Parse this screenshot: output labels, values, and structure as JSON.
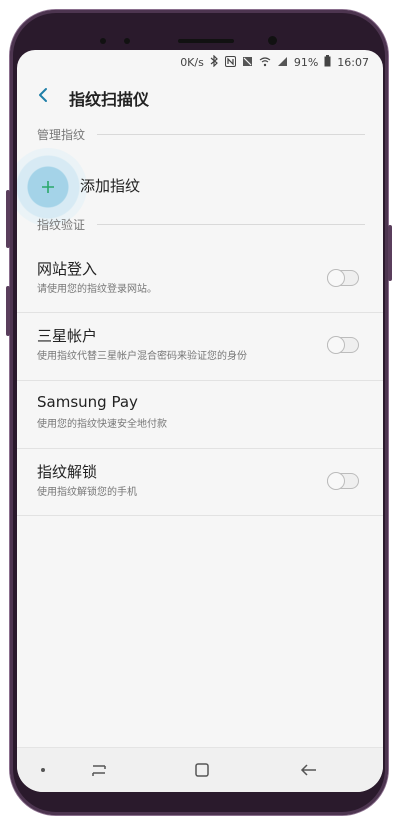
{
  "status_bar": {
    "speed": "0K/s",
    "battery": "91%",
    "time": "16:07"
  },
  "header": {
    "title": "指纹扫描仪"
  },
  "sections": {
    "manage": "管理指纹",
    "verify": "指纹验证"
  },
  "add_fingerprint": {
    "label": "添加指纹"
  },
  "items": [
    {
      "title": "网站登入",
      "subtitle": "请使用您的指纹登录网站。"
    },
    {
      "title": "三星帐户",
      "subtitle": "使用指纹代替三星帐户混合密码来验证您的身份"
    },
    {
      "title": "Samsung Pay",
      "subtitle": "使用您的指纹快速安全地付款"
    },
    {
      "title": "指纹解锁",
      "subtitle": "使用指纹解锁您的手机"
    }
  ],
  "colors": {
    "accent": "#2aa86a",
    "frame": "#2a1a2c"
  },
  "icons": {
    "back": "back-arrow-icon",
    "add": "plus-icon",
    "nav_left": "recent-apps-icon",
    "nav_home": "home-icon",
    "nav_back": "back-icon"
  }
}
